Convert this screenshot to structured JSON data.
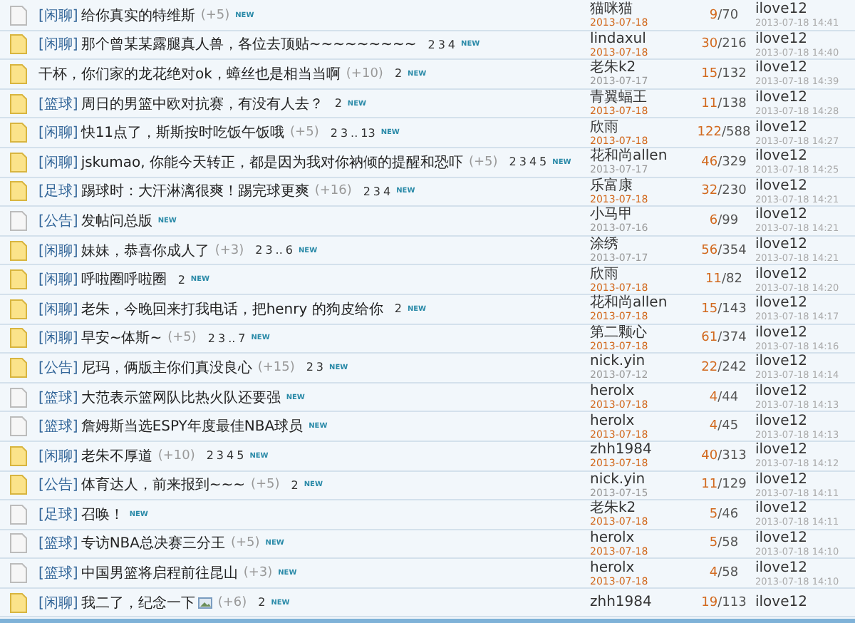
{
  "threads": [
    {
      "hot": false,
      "category": "[闲聊]",
      "title": "给你真实的特维斯",
      "bonus": "(+5)",
      "has_image": false,
      "badge": "NEW",
      "author": "猫咪猫",
      "date": "2013-07-18",
      "date_recent": true,
      "replies": "9",
      "views": "/70",
      "last_user": "ilove12",
      "last_time": "2013-07-18 14:41"
    },
    {
      "hot": true,
      "category": "[闲聊]",
      "title": "那个曾某某露腿真人兽，各位去顶贴~~~~~~~~~",
      "pages": [
        "2",
        "3",
        "4"
      ],
      "has_image": false,
      "badge": "NEW",
      "author": "lindaxul",
      "date": "2013-07-18",
      "date_recent": true,
      "replies": "30",
      "views": "/216",
      "last_user": "ilove12",
      "last_time": "2013-07-18 14:40"
    },
    {
      "hot": true,
      "title": "干杯，你们家的龙花绝对ok，蟑丝也是相当当啊",
      "bonus": "(+10)",
      "pages": [
        "2"
      ],
      "has_image": false,
      "badge": "NEW",
      "author": "老朱k2",
      "date": "2013-07-17",
      "date_recent": false,
      "replies": "15",
      "views": "/132",
      "last_user": "ilove12",
      "last_time": "2013-07-18 14:39"
    },
    {
      "hot": true,
      "category": "[篮球]",
      "title": "周日的男篮中欧对抗赛，有没有人去？",
      "pages": [
        "2"
      ],
      "has_image": false,
      "badge": "NEW",
      "author": "青翼蝠王",
      "date": "2013-07-18",
      "date_recent": true,
      "replies": "11",
      "views": "/138",
      "last_user": "ilove12",
      "last_time": "2013-07-18 14:28"
    },
    {
      "hot": true,
      "category": "[闲聊]",
      "title": "快11点了，斯斯按时吃饭午饭哦",
      "bonus": "(+5)",
      "pages": [
        "2",
        "3",
        "..",
        "13"
      ],
      "has_image": false,
      "badge": "NEW",
      "author": "欣雨",
      "date": "2013-07-18",
      "date_recent": true,
      "replies": "122",
      "views": "/588",
      "last_user": "ilove12",
      "last_time": "2013-07-18 14:27"
    },
    {
      "hot": true,
      "category": "[闲聊]",
      "title": "jskumao, 你能今天转正，都是因为我对你衲倾的提醒和恐吓",
      "bonus": "(+5)",
      "pages": [
        "2",
        "3",
        "4",
        "5"
      ],
      "has_image": false,
      "badge": "NEW",
      "author": "花和尚allen",
      "date": "2013-07-17",
      "date_recent": false,
      "replies": "46",
      "views": "/329",
      "last_user": "ilove12",
      "last_time": "2013-07-18 14:25"
    },
    {
      "hot": true,
      "category": "[足球]",
      "title": "踢球时：大汗淋漓很爽！踢完球更爽",
      "bonus": "(+16)",
      "pages": [
        "2",
        "3",
        "4"
      ],
      "has_image": false,
      "badge": "NEW",
      "author": "乐富康",
      "date": "2013-07-18",
      "date_recent": true,
      "replies": "32",
      "views": "/230",
      "last_user": "ilove12",
      "last_time": "2013-07-18 14:21"
    },
    {
      "hot": false,
      "category": "[公告]",
      "title": "发帖问总版",
      "has_image": false,
      "badge": "NEW",
      "author": "小马甲",
      "date": "2013-07-16",
      "date_recent": false,
      "replies": "6",
      "views": "/99",
      "last_user": "ilove12",
      "last_time": "2013-07-18 14:21"
    },
    {
      "hot": true,
      "category": "[闲聊]",
      "title": "妹妹，恭喜你成人了",
      "bonus": "(+3)",
      "pages": [
        "2",
        "3",
        "..",
        "6"
      ],
      "has_image": false,
      "badge": "NEW",
      "author": "涂绣",
      "date": "2013-07-17",
      "date_recent": false,
      "replies": "56",
      "views": "/354",
      "last_user": "ilove12",
      "last_time": "2013-07-18 14:21"
    },
    {
      "hot": true,
      "category": "[闲聊]",
      "title": "呼啦圈呼啦圈",
      "pages": [
        "2"
      ],
      "has_image": false,
      "badge": "NEW",
      "author": "欣雨",
      "date": "2013-07-18",
      "date_recent": true,
      "replies": "11",
      "views": "/82",
      "last_user": "ilove12",
      "last_time": "2013-07-18 14:20"
    },
    {
      "hot": true,
      "category": "[闲聊]",
      "title": "老朱，今晚回来打我电话，把henry 的狗皮给你",
      "pages": [
        "2"
      ],
      "has_image": false,
      "badge": "NEW",
      "author": "花和尚allen",
      "date": "2013-07-18",
      "date_recent": true,
      "replies": "15",
      "views": "/143",
      "last_user": "ilove12",
      "last_time": "2013-07-18 14:17"
    },
    {
      "hot": true,
      "category": "[闲聊]",
      "title": "早安~体斯~",
      "bonus": "(+5)",
      "pages": [
        "2",
        "3",
        "..",
        "7"
      ],
      "has_image": false,
      "badge": "NEW",
      "author": "第二颗心",
      "date": "2013-07-18",
      "date_recent": true,
      "replies": "61",
      "views": "/374",
      "last_user": "ilove12",
      "last_time": "2013-07-18 14:16"
    },
    {
      "hot": true,
      "category": "[公告]",
      "title": "尼玛，俩版主你们真没良心",
      "bonus": "(+15)",
      "pages": [
        "2",
        "3"
      ],
      "has_image": false,
      "badge": "NEW",
      "author": "nick.yin",
      "date": "2013-07-12",
      "date_recent": false,
      "replies": "22",
      "views": "/242",
      "last_user": "ilove12",
      "last_time": "2013-07-18 14:14"
    },
    {
      "hot": false,
      "category": "[篮球]",
      "title": "大范表示篮网队比热火队还要强",
      "has_image": false,
      "badge": "NEW",
      "author": "herolx",
      "date": "2013-07-18",
      "date_recent": true,
      "replies": "4",
      "views": "/44",
      "last_user": "ilove12",
      "last_time": "2013-07-18 14:13"
    },
    {
      "hot": false,
      "category": "[篮球]",
      "title": "詹姆斯当选ESPY年度最佳NBA球员",
      "has_image": false,
      "badge": "NEW",
      "author": "herolx",
      "date": "2013-07-18",
      "date_recent": true,
      "replies": "4",
      "views": "/45",
      "last_user": "ilove12",
      "last_time": "2013-07-18 14:13"
    },
    {
      "hot": true,
      "category": "[闲聊]",
      "title": "老朱不厚道",
      "bonus": "(+10)",
      "pages": [
        "2",
        "3",
        "4",
        "5"
      ],
      "has_image": false,
      "badge": "NEW",
      "author": "zhh1984",
      "date": "2013-07-18",
      "date_recent": true,
      "replies": "40",
      "views": "/313",
      "last_user": "ilove12",
      "last_time": "2013-07-18 14:12"
    },
    {
      "hot": true,
      "category": "[公告]",
      "title": "体育达人，前来报到~~~",
      "bonus": "(+5)",
      "pages": [
        "2"
      ],
      "has_image": false,
      "badge": "NEW",
      "author": "nick.yin",
      "date": "2013-07-15",
      "date_recent": false,
      "replies": "11",
      "views": "/129",
      "last_user": "ilove12",
      "last_time": "2013-07-18 14:11"
    },
    {
      "hot": false,
      "category": "[足球]",
      "title": "召唤！",
      "has_image": false,
      "badge": "NEW",
      "author": "老朱k2",
      "date": "2013-07-18",
      "date_recent": true,
      "replies": "5",
      "views": "/46",
      "last_user": "ilove12",
      "last_time": "2013-07-18 14:11"
    },
    {
      "hot": false,
      "category": "[篮球]",
      "title": "专访NBA总决赛三分王",
      "bonus": "(+5)",
      "has_image": false,
      "badge": "NEW",
      "author": "herolx",
      "date": "2013-07-18",
      "date_recent": true,
      "replies": "5",
      "views": "/58",
      "last_user": "ilove12",
      "last_time": "2013-07-18 14:10"
    },
    {
      "hot": false,
      "category": "[篮球]",
      "title": "中国男篮将启程前往昆山",
      "bonus": "(+3)",
      "has_image": false,
      "badge": "NEW",
      "author": "herolx",
      "date": "2013-07-18",
      "date_recent": true,
      "replies": "4",
      "views": "/58",
      "last_user": "ilove12",
      "last_time": "2013-07-18 14:10"
    },
    {
      "hot": true,
      "category": "[闲聊]",
      "title": "我二了，纪念一下",
      "bonus": "(+6)",
      "pages": [
        "2"
      ],
      "has_image": true,
      "badge": "NEW",
      "author": "zhh1984",
      "replies": "19",
      "views": "/113",
      "last_user": "ilove12"
    }
  ]
}
